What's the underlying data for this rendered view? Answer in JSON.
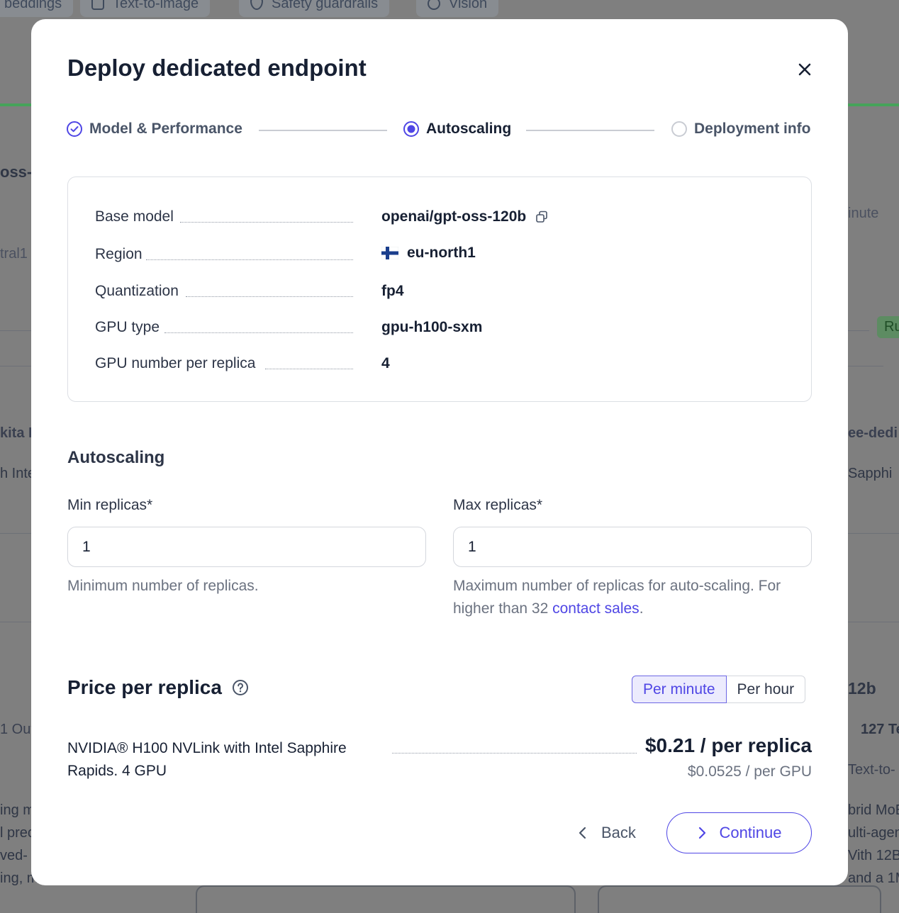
{
  "background": {
    "top_tabs": [
      "beddings",
      "Text-to-image",
      "Safety guardrails",
      "Vision"
    ],
    "fragments": [
      "oss-",
      "tral1",
      "kita K",
      "h Inte",
      "1 Out",
      "ing m",
      "l prec",
      "ved-",
      "ing, m",
      "inute",
      "Ru",
      "ee-dedi",
      "Sapphi",
      "12b",
      "127 Te",
      "Text-to-",
      "brid MoE",
      "ulti-agen",
      "Vith 12B",
      "and a 1M"
    ]
  },
  "modal": {
    "title": "Deploy dedicated endpoint",
    "steps": [
      {
        "label": "Model & Performance",
        "state": "completed"
      },
      {
        "label": "Autoscaling",
        "state": "active"
      },
      {
        "label": "Deployment info",
        "state": "pending"
      }
    ],
    "summary": {
      "rows": [
        {
          "label": "Base model",
          "value": "openai/gpt-oss-120b",
          "icon": "copy-icon"
        },
        {
          "label": "Region",
          "value": "eu-north1",
          "icon": "finland-flag-icon"
        },
        {
          "label": "Quantization",
          "value": "fp4"
        },
        {
          "label": "GPU type",
          "value": "gpu-h100-sxm"
        },
        {
          "label": "GPU number per replica",
          "value": "4"
        }
      ]
    },
    "autoscaling": {
      "title": "Autoscaling",
      "min": {
        "label": "Min replicas*",
        "value": "1",
        "helper": "Minimum number of replicas."
      },
      "max": {
        "label": "Max replicas*",
        "value": "1",
        "helper_prefix": "Maximum number of replicas for auto-scaling. For higher than 32 ",
        "helper_link": "contact sales",
        "helper_suffix": "."
      }
    },
    "pricing": {
      "title": "Price per replica",
      "toggle": {
        "selected": "Per minute",
        "options": [
          "Per minute",
          "Per hour"
        ]
      },
      "gpu_description": "NVIDIA® H100 NVLink with Intel Sapphire Rapids. 4 GPU",
      "price_main": "$0.21 / per replica",
      "price_sub": "$0.0525 / per GPU"
    },
    "footer": {
      "back": "Back",
      "continue": "Continue"
    },
    "colors": {
      "accent": "#4f46e5",
      "text": "#172033",
      "muted": "#6b7280",
      "overlay": "#7f7f7f"
    }
  }
}
